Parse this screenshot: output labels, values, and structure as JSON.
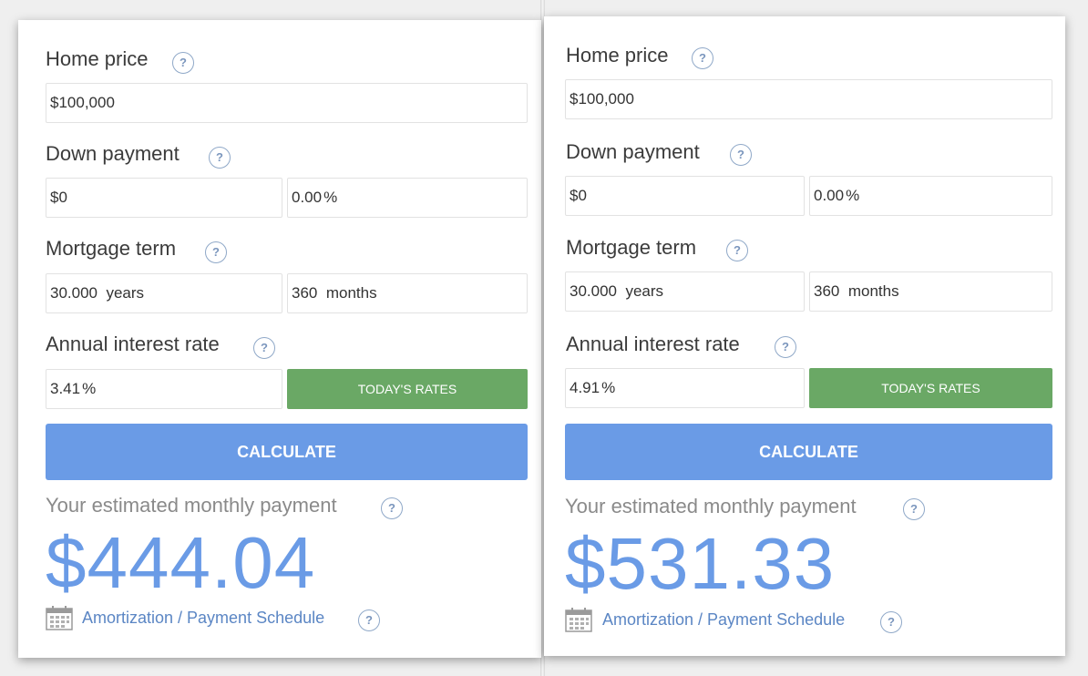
{
  "calculators": [
    {
      "home_price_label": "Home price",
      "home_price_value": "$100,000",
      "down_payment_label": "Down payment",
      "down_payment_amount": "$0",
      "down_payment_percent": "0.00",
      "mortgage_term_label": "Mortgage term",
      "term_years": "30.000",
      "term_years_unit": "years",
      "term_months": "360",
      "term_months_unit": "months",
      "interest_rate_label": "Annual interest rate",
      "interest_rate_value": "3.41",
      "todays_rates_label": "TODAY'S RATES",
      "calculate_label": "CALCULATE",
      "estimate_label": "Your estimated monthly payment",
      "monthly_payment": "$444.04",
      "amortization_label": "Amortization / Payment Schedule"
    },
    {
      "home_price_label": "Home price",
      "home_price_value": "$100,000",
      "down_payment_label": "Down payment",
      "down_payment_amount": "$0",
      "down_payment_percent": "0.00",
      "mortgage_term_label": "Mortgage term",
      "term_years": "30.000",
      "term_years_unit": "years",
      "term_months": "360",
      "term_months_unit": "months",
      "interest_rate_label": "Annual interest rate",
      "interest_rate_value": "4.91",
      "todays_rates_label": "TODAY'S RATES",
      "calculate_label": "CALCULATE",
      "estimate_label": "Your estimated monthly payment",
      "monthly_payment": "$531.33",
      "amortization_label": "Amortization / Payment Schedule"
    }
  ],
  "help_glyph": "?",
  "percent_sign": "%",
  "colors": {
    "accent_blue": "#6a9be6",
    "rates_green": "#6aa865",
    "link_blue": "#5b86c4"
  },
  "icons": {
    "help": "question-circle-icon",
    "calendar": "calendar-icon"
  }
}
